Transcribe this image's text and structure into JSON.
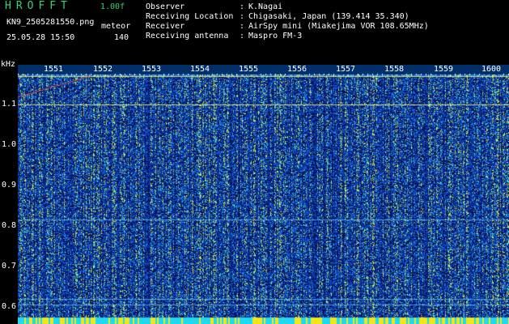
{
  "app": {
    "title": "HROFFT",
    "version": "1.00f"
  },
  "file": {
    "name": "KN9_2505281550.png",
    "mode": "meteor",
    "datetime": "25.05.28 15:50",
    "count": "140"
  },
  "meta": [
    {
      "key": "Observer",
      "value": "K.Nagai"
    },
    {
      "key": "Receiving Location",
      "value": "Chigasaki, Japan (139.414 35.340)"
    },
    {
      "key": "Receiver",
      "value": "AirSpy mini (Miakejima VOR 108.65MHz)"
    },
    {
      "key": "Receiving antenna",
      "value": "Maspro FM-3"
    }
  ],
  "axis": {
    "unit": "kHz",
    "x_ticks": [
      "1551",
      "1552",
      "1553",
      "1554",
      "1555",
      "1556",
      "1557",
      "1558",
      "1559",
      "1600"
    ],
    "y_ticks": [
      "1.1",
      "1.0",
      "0.9",
      "0.8",
      "0.7",
      "0.6"
    ]
  },
  "colors": {
    "background": "#000000",
    "deep": "#06124f",
    "mid": "#1645c8",
    "hot": "#20d8f0",
    "accent": "#32d27a",
    "peak": "#f2e61a"
  }
}
